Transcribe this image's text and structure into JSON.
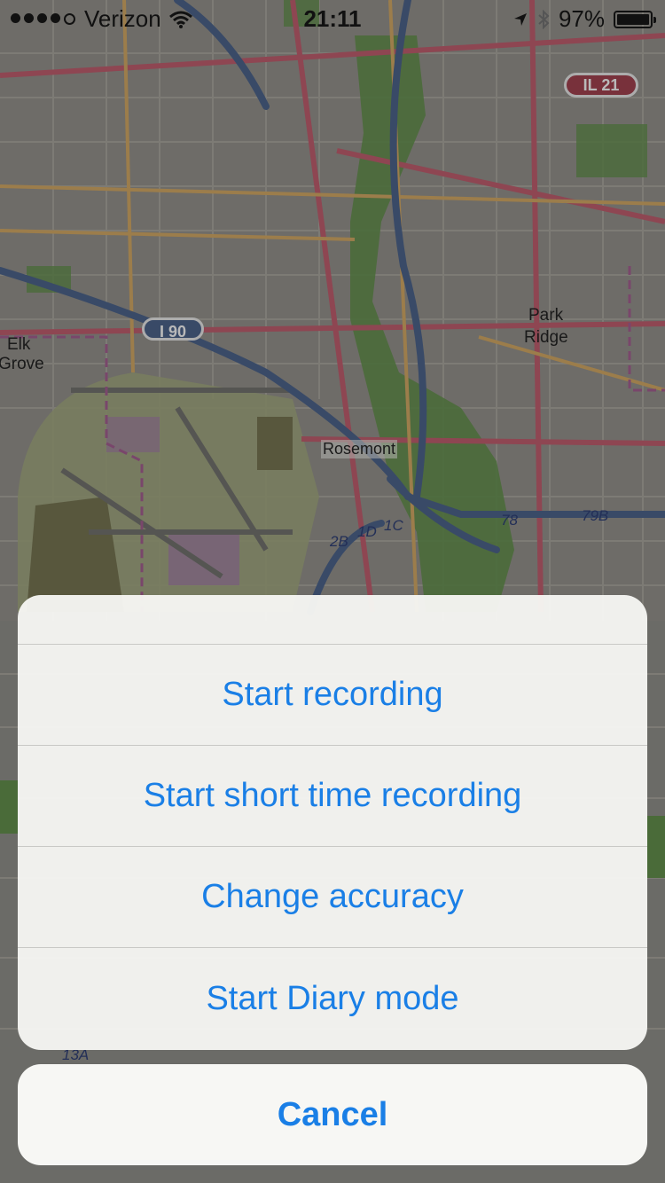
{
  "status_bar": {
    "carrier": "Verizon",
    "time": "21:11",
    "battery": "97%",
    "signal_bars_filled": 4,
    "signal_bars_total": 5,
    "battery_level": 0.97
  },
  "map": {
    "labels": {
      "park_ridge_1": "Park",
      "park_ridge_2": "Ridge",
      "elk_1": "Elk",
      "elk_2": "Grove",
      "rosemont": "Rosemont",
      "i90": "I 90",
      "il21": "IL 21",
      "exit_78": "78",
      "exit_79b": "79B",
      "exit_1c": "1C",
      "exit_1d": "1D",
      "exit_2b": "2B",
      "exit_13a": "13A"
    }
  },
  "sheet": {
    "actions": [
      {
        "label": "Start recording"
      },
      {
        "label": "Start short time recording"
      },
      {
        "label": "Change accuracy"
      },
      {
        "label": "Start Diary mode"
      }
    ],
    "cancel_label": "Cancel"
  },
  "colors": {
    "accent": "#1a7fe6",
    "sheet_bg": "#f6f6f2",
    "park_green": "#5f8a4a",
    "road_pink": "#b65a6a",
    "road_orange": "#c8a060",
    "highway_blue": "#4a5f85"
  }
}
